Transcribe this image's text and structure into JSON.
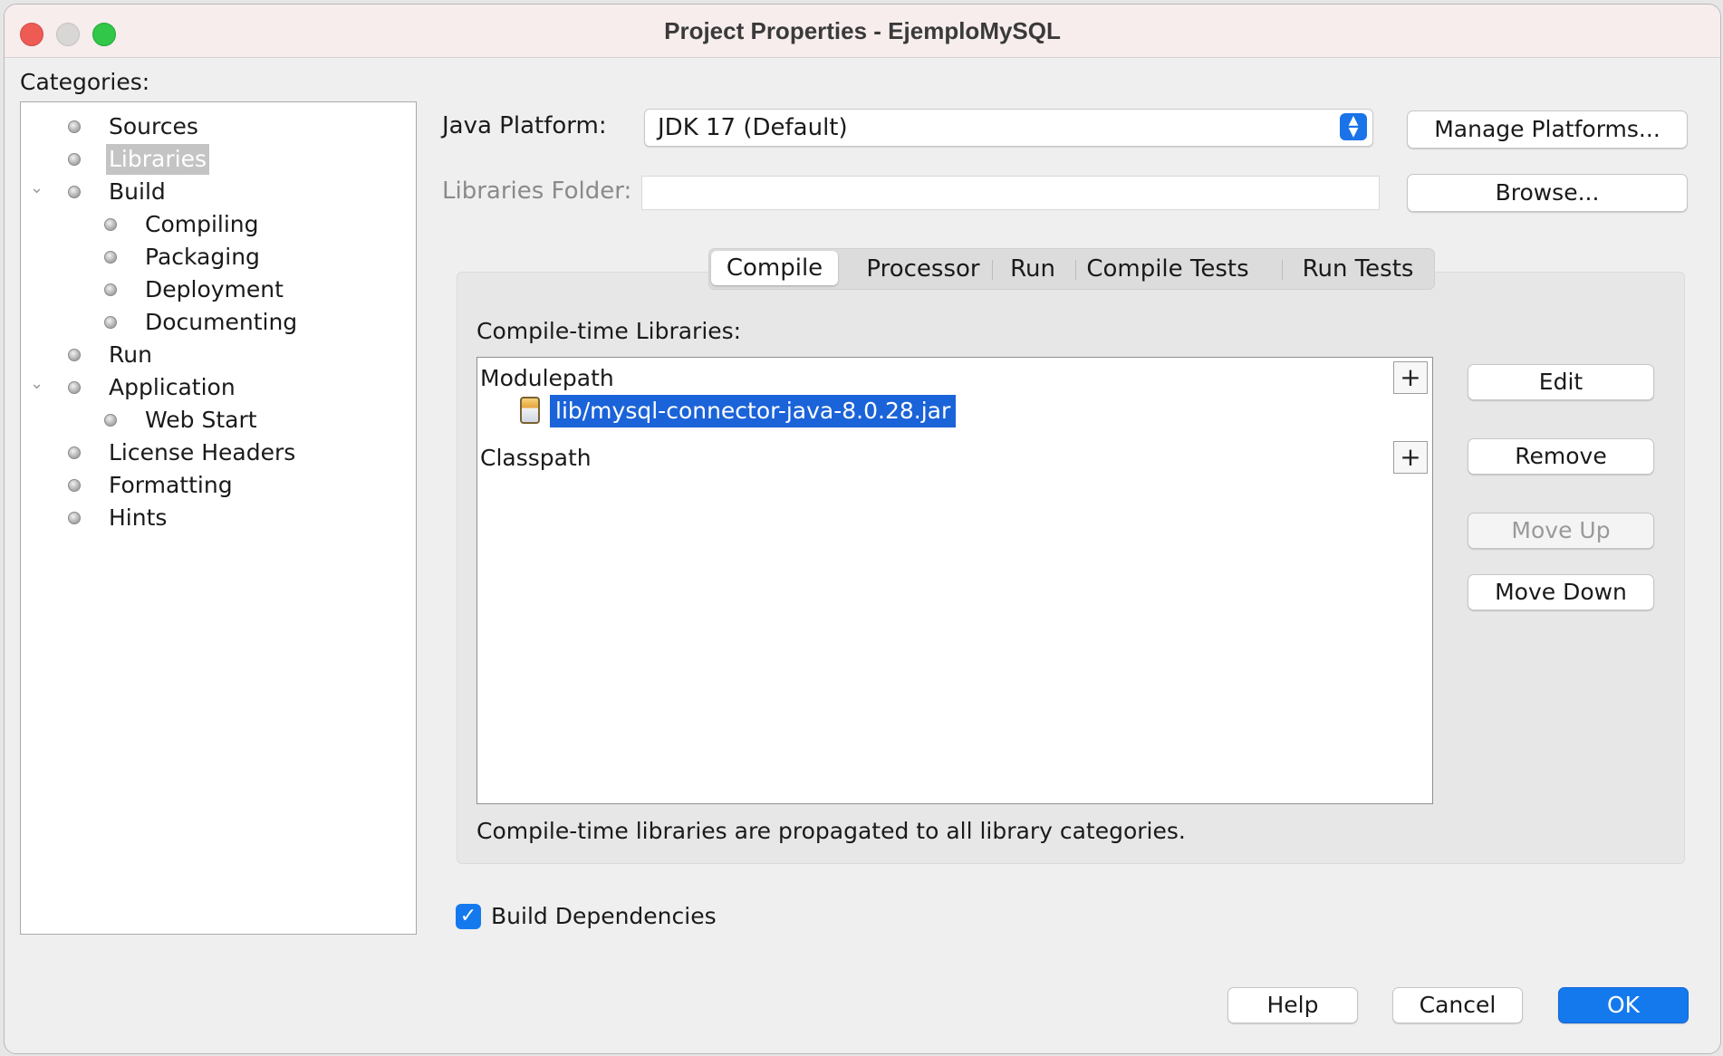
{
  "window": {
    "title": "Project Properties - EjemploMySQL"
  },
  "categories": {
    "label": "Categories:",
    "items": [
      {
        "label": "Sources",
        "level": 0,
        "selected": false,
        "expandable": false
      },
      {
        "label": "Libraries",
        "level": 0,
        "selected": true,
        "expandable": false
      },
      {
        "label": "Build",
        "level": 0,
        "selected": false,
        "expandable": true
      },
      {
        "label": "Compiling",
        "level": 1,
        "selected": false,
        "expandable": false
      },
      {
        "label": "Packaging",
        "level": 1,
        "selected": false,
        "expandable": false
      },
      {
        "label": "Deployment",
        "level": 1,
        "selected": false,
        "expandable": false
      },
      {
        "label": "Documenting",
        "level": 1,
        "selected": false,
        "expandable": false
      },
      {
        "label": "Run",
        "level": 0,
        "selected": false,
        "expandable": false
      },
      {
        "label": "Application",
        "level": 0,
        "selected": false,
        "expandable": true
      },
      {
        "label": "Web Start",
        "level": 1,
        "selected": false,
        "expandable": false
      },
      {
        "label": "License Headers",
        "level": 0,
        "selected": false,
        "expandable": false
      },
      {
        "label": "Formatting",
        "level": 0,
        "selected": false,
        "expandable": false
      },
      {
        "label": "Hints",
        "level": 0,
        "selected": false,
        "expandable": false
      }
    ]
  },
  "platform": {
    "label": "Java Platform:",
    "value": "JDK 17 (Default)",
    "manage_button": "Manage Platforms..."
  },
  "libraries_folder": {
    "label": "Libraries Folder:",
    "value": "",
    "browse_button": "Browse..."
  },
  "tabs": [
    "Compile",
    "Processor",
    "Run",
    "Compile Tests",
    "Run Tests"
  ],
  "active_tab": "Compile",
  "compile": {
    "list_label": "Compile-time Libraries:",
    "modulepath_label": "Modulepath",
    "modulepath_items": [
      "lib/mysql-connector-java-8.0.28.jar"
    ],
    "classpath_label": "Classpath",
    "plus_symbol": "+",
    "note": "Compile-time libraries are propagated to all library categories.",
    "buttons": {
      "edit": "Edit",
      "remove": "Remove",
      "move_up": "Move Up",
      "move_down": "Move Down"
    }
  },
  "build_dependencies": {
    "label": "Build Dependencies",
    "checked": true,
    "check_mark": "✓"
  },
  "footer": {
    "help": "Help",
    "cancel": "Cancel",
    "ok": "OK"
  },
  "colors": {
    "accent": "#1579ee",
    "selection": "#1b63d8",
    "tree_selection": "#c4c4c4"
  }
}
